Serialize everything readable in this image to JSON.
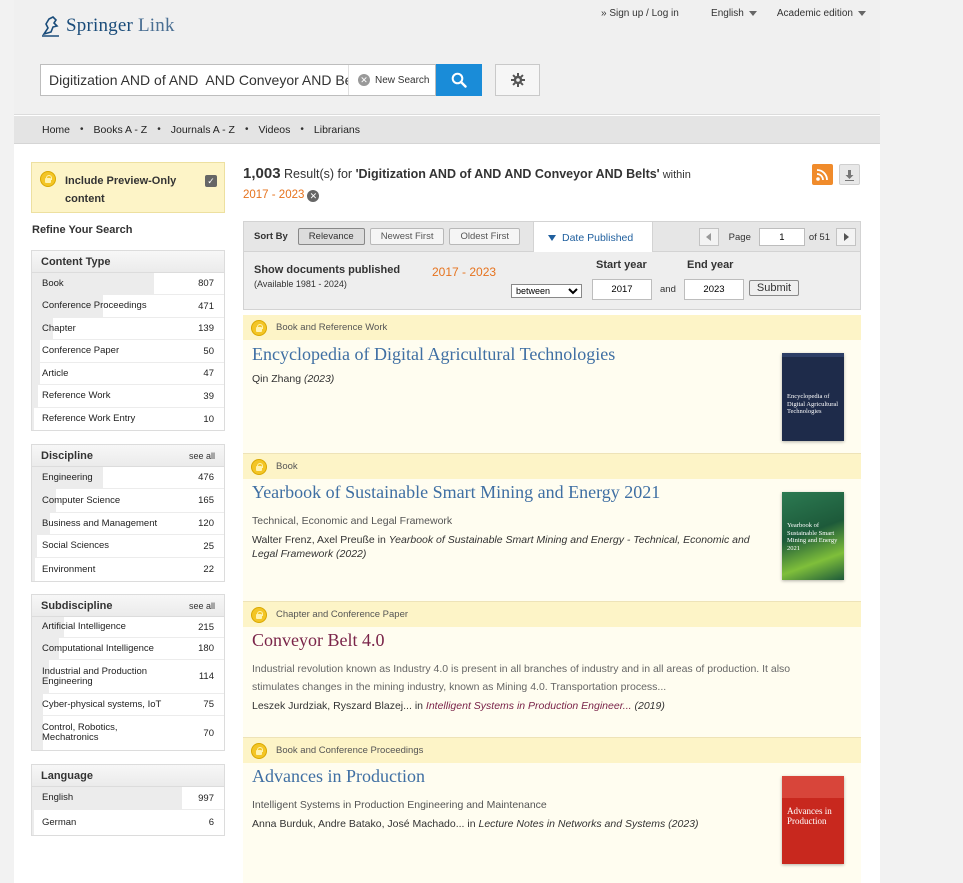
{
  "header": {
    "logo": {
      "brand": "Springer",
      "product": "Link"
    },
    "signin": "» Sign up / Log in",
    "language": "English",
    "edition": "Academic edition"
  },
  "search": {
    "value": "Digitization AND of AND  AND Conveyor AND Belts",
    "new_search": "New Search"
  },
  "nav": [
    "Home",
    "Books A - Z",
    "Journals A - Z",
    "Videos",
    "Librarians"
  ],
  "sidebar": {
    "preview_label": "Include Preview-Only content",
    "refine_title": "Refine Your Search",
    "facets": [
      {
        "title": "Content Type",
        "see_all": "",
        "items": [
          {
            "label": "Book",
            "count": "807",
            "fill": 0.8
          },
          {
            "label": "Conference Proceedings",
            "count": "471",
            "fill": 0.47
          },
          {
            "label": "Chapter",
            "count": "139",
            "fill": 0.14
          },
          {
            "label": "Conference Paper",
            "count": "50",
            "fill": 0.05
          },
          {
            "label": "Article",
            "count": "47",
            "fill": 0.05
          },
          {
            "label": "Reference Work",
            "count": "39",
            "fill": 0.04
          },
          {
            "label": "Reference Work Entry",
            "count": "10",
            "fill": 0.01
          }
        ]
      },
      {
        "title": "Discipline",
        "see_all": "see all",
        "items": [
          {
            "label": "Engineering",
            "count": "476",
            "fill": 0.47
          },
          {
            "label": "Computer Science",
            "count": "165",
            "fill": 0.16
          },
          {
            "label": "Business and Management",
            "count": "120",
            "fill": 0.12
          },
          {
            "label": "Social Sciences",
            "count": "25",
            "fill": 0.03
          },
          {
            "label": "Environment",
            "count": "22",
            "fill": 0.02
          }
        ]
      },
      {
        "title": "Subdiscipline",
        "see_all": "see all",
        "items": [
          {
            "label": "Artificial Intelligence",
            "count": "215",
            "fill": 0.21
          },
          {
            "label": "Computational Intelligence",
            "count": "180",
            "fill": 0.18
          },
          {
            "label": "Industrial and Production Engineering",
            "count": "114",
            "fill": 0.11
          },
          {
            "label": "Cyber-physical systems, IoT",
            "count": "75",
            "fill": 0.07
          },
          {
            "label": "Control, Robotics, Mechatronics",
            "count": "70",
            "fill": 0.07
          }
        ]
      },
      {
        "title": "Language",
        "see_all": "",
        "items": [
          {
            "label": "English",
            "count": "997",
            "fill": 0.99
          },
          {
            "label": "German",
            "count": "6",
            "fill": 0.01
          }
        ]
      }
    ]
  },
  "results_header": {
    "count": "1,003",
    "results_for": " Result(s) for ",
    "query": "'Digitization AND of AND AND Conveyor AND Belts'",
    "within": " within",
    "range": "2017 - 2023"
  },
  "sort": {
    "label": "Sort By",
    "options": [
      "Relevance",
      "Newest First",
      "Oldest First"
    ],
    "date_tab": "Date Published",
    "page_label": "Page",
    "page_value": "1",
    "page_of": "of 51"
  },
  "date_filter": {
    "show": "Show documents published",
    "available": "(Available 1981 - 2024)",
    "range": "2017 - 2023",
    "mode": "between",
    "start_label": "Start year",
    "end_label": "End year",
    "start": "2017",
    "end": "2023",
    "and": "and",
    "submit": "Submit"
  },
  "results": [
    {
      "type": "Book and Reference Work",
      "title": "Encyclopedia of Digital Agricultural Technologies",
      "authors": "Qin Zhang",
      "year": "(2023)",
      "cover_text": "Encyclopedia of Digital Agricultural Technologies",
      "cover_color": "#1e2b4a"
    },
    {
      "type": "Book",
      "title": "Yearbook of Sustainable Smart Mining and Energy 2021",
      "subtitle": "Technical, Economic and Legal Framework",
      "authors": "Walter Frenz, Axel Preuße",
      "in": " in ",
      "source": "Yearbook of Sustainable Smart Mining and Energy - Technical, Economic and Legal Framework (2022)",
      "cover_text": "Yearbook of Sustainable Smart Mining and Energy 2021",
      "cover_color": "#1d5a3a"
    },
    {
      "type": "Chapter and Conference Paper",
      "title": "Conveyor Belt 4.0",
      "snippet": "Industrial revolution known as Industry 4.0 is present in all branches of industry and in all areas of production. It also stimulates changes in the mining industry, known as Mining 4.0. Transportation process...",
      "authors": "Leszek Jurdziak, Ryszard Blazej...",
      "in": " in ",
      "source": "Intelligent Systems in Production Engineer...",
      "year": " (2019)"
    },
    {
      "type": "Book and Conference Proceedings",
      "title": "Advances in Production",
      "subtitle": "Intelligent Systems in Production Engineering and Maintenance",
      "authors": "Anna Burduk, Andre Batako, José Machado...",
      "in": " in ",
      "source": "Lecture Notes in Networks and Systems (2023)",
      "cover_text": "Advances in Production",
      "cover_color": "#c8281e"
    }
  ]
}
